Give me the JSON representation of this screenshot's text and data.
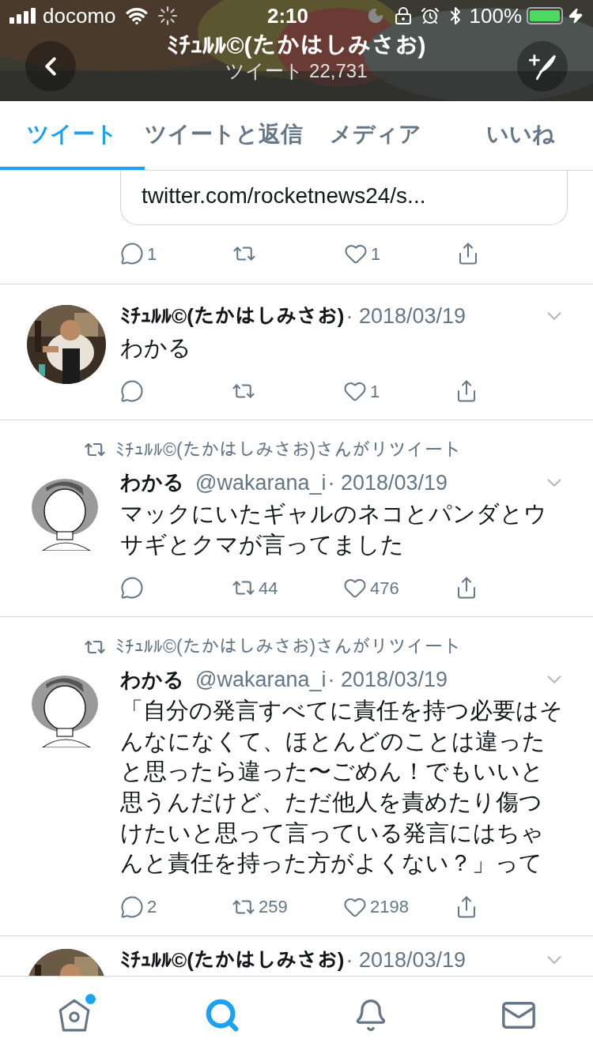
{
  "status_bar": {
    "carrier": "docomo",
    "time": "2:10",
    "battery": "100%"
  },
  "header": {
    "title": "ﾐﾁｭﾙﾙ©(たかはしみさお)",
    "subtitle": "ツイート 22,731"
  },
  "tabs": [
    {
      "label": "ツイート",
      "selected": true
    },
    {
      "label": "ツイートと返信",
      "selected": false
    },
    {
      "label": "メディア",
      "selected": false
    },
    {
      "label": "いいね",
      "selected": false
    }
  ],
  "tweets": [
    {
      "card_url": "twitter.com/rocketnews24/s...",
      "actions": {
        "reply": "1",
        "like": "1"
      }
    },
    {
      "avatar": {
        "kind": "picture"
      },
      "name": "ﾐﾁｭﾙﾙ©(たかはしみさお)",
      "date": "· 2018/03/19",
      "text_lines": [
        "わかる"
      ],
      "actions": {
        "like": "1"
      }
    },
    {
      "retweeted_by": "ﾐﾁｭﾙﾙ©(たかはしみさお)さんがリツイート",
      "avatar": {
        "kind": "picture"
      },
      "name": "わかる",
      "handle": "@wakarana_i",
      "date": "· 2018/03/19",
      "text_lines": [
        "マックにいたギャルのネコとパンダとウ",
        "サギとクマが言ってました"
      ],
      "actions": {
        "retweet": "44",
        "like": "476"
      }
    },
    {
      "retweeted_by": "ﾐﾁｭﾙﾙ©(たかはしみさお)さんがリツイート",
      "avatar": {
        "kind": "picture"
      },
      "name": "わかる",
      "handle": "@wakarana_i",
      "date": "· 2018/03/19",
      "text_lines": [
        "「自分の発言すべてに責任を持つ必要はそ",
        "んなになくて、ほとんどのことは違った",
        "と思ったら違った〜ごめん！でもいいと",
        "思うんだけど、ただ他人を責めたり傷つ",
        "けたいと思って言っている発言にはちゃ",
        "んと責任を持った方がよくない？」って"
      ],
      "actions": {
        "reply": "2",
        "retweet": "259",
        "like": "2198"
      }
    },
    {
      "avatar": {
        "kind": "picture"
      },
      "name": "ﾐﾁｭﾙﾙ©(たかはしみさお)",
      "date": "· 2018/03/19"
    }
  ],
  "nav": [
    {
      "kind": "home",
      "selected": false,
      "badge": true
    },
    {
      "kind": "search",
      "selected": true,
      "badge": false
    },
    {
      "kind": "notifications",
      "selected": false,
      "badge": false
    },
    {
      "kind": "messages",
      "selected": false,
      "badge": false
    }
  ]
}
